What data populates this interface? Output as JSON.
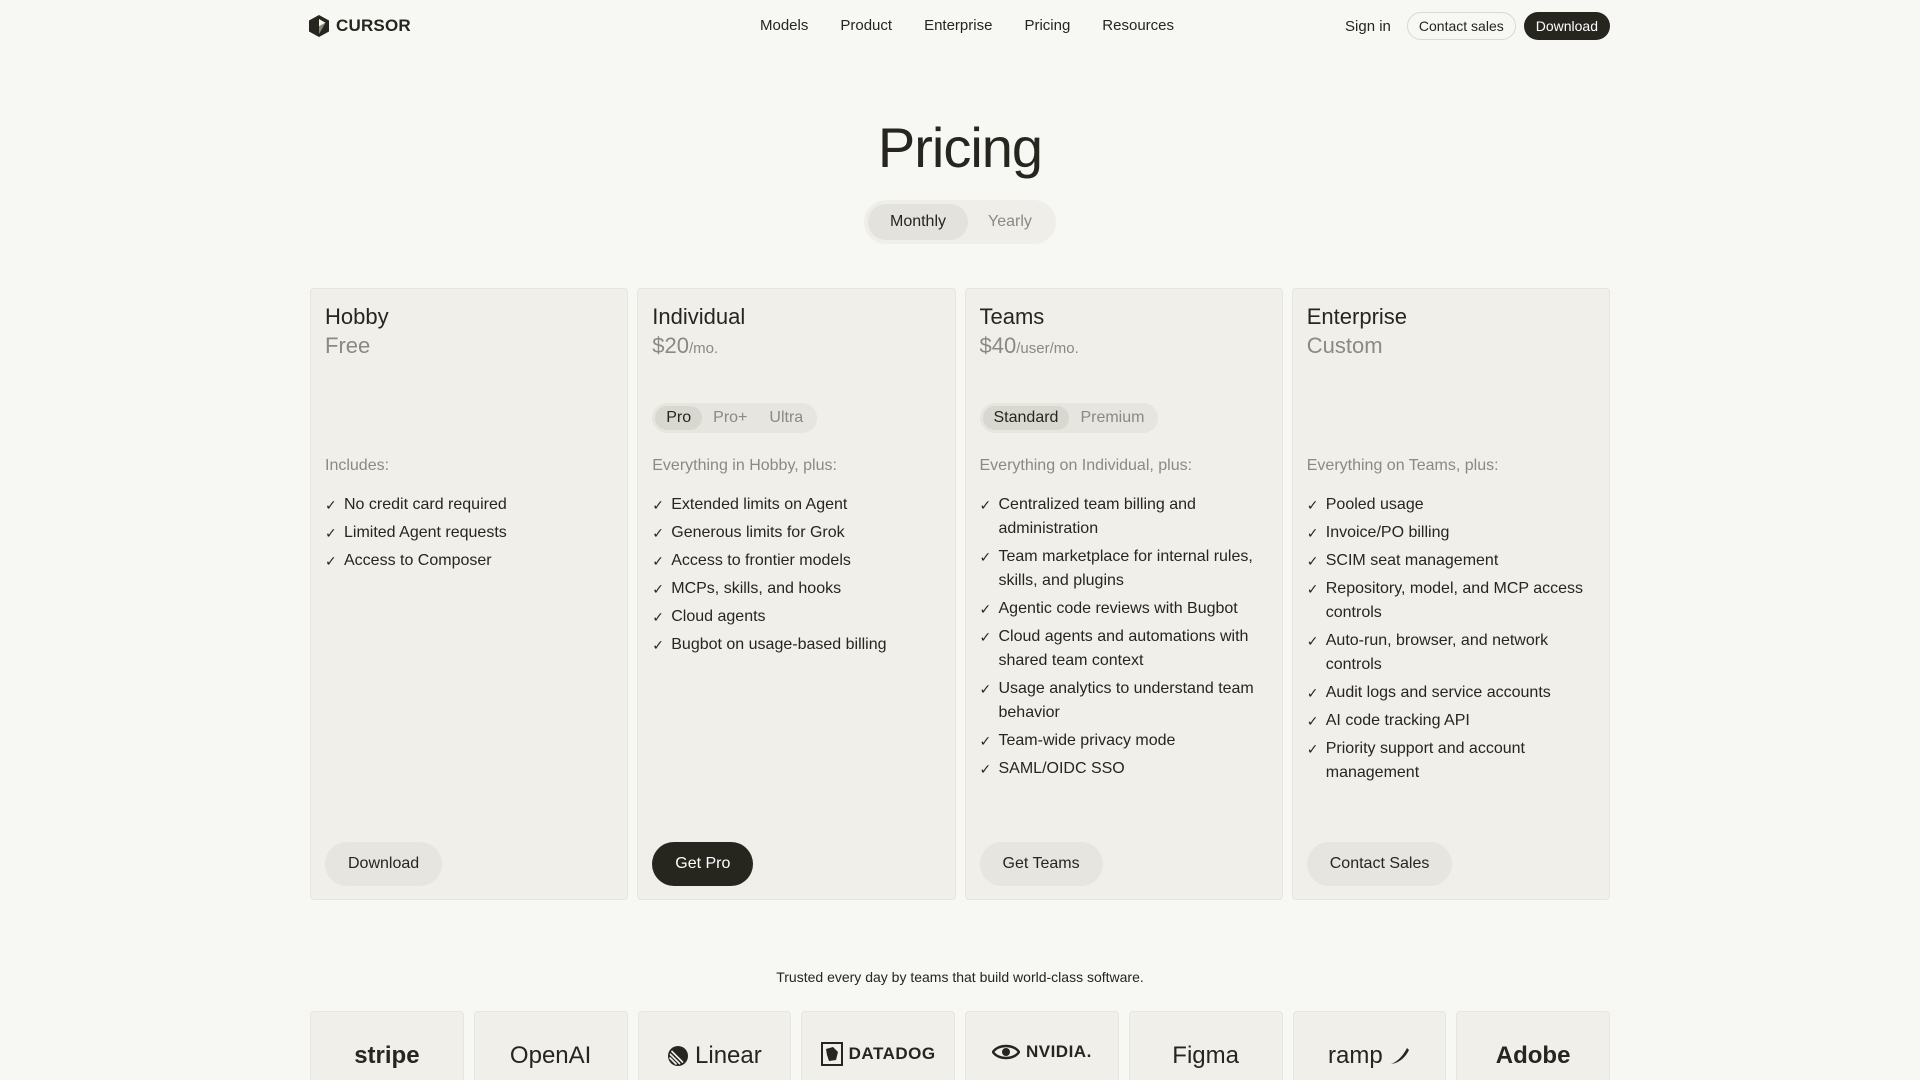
{
  "nav": {
    "brand": "CURSOR",
    "links": [
      "Models",
      "Product",
      "Enterprise",
      "Pricing",
      "Resources"
    ],
    "sign_in": "Sign in",
    "contact_sales": "Contact sales",
    "download": "Download"
  },
  "hero": {
    "title": "Pricing",
    "period_options": [
      "Monthly",
      "Yearly"
    ],
    "selected_period": "Monthly"
  },
  "plans": [
    {
      "name": "Hobby",
      "price": "Free",
      "price_unit": "",
      "tiers": [],
      "includes_label": "Includes:",
      "features": [
        "No credit card required",
        "Limited Agent requests",
        "Access to Composer"
      ],
      "cta": "Download"
    },
    {
      "name": "Individual",
      "price": "$20",
      "price_unit": "/mo.",
      "tiers": [
        "Pro",
        "Pro+",
        "Ultra"
      ],
      "selected_tier": "Pro",
      "includes_label": "Everything in Hobby, plus:",
      "features": [
        "Extended limits on Agent",
        "Generous limits for Grok",
        "Access to frontier models",
        "MCPs, skills, and hooks",
        "Cloud agents",
        "Bugbot on usage-based billing"
      ],
      "cta": "Get Pro"
    },
    {
      "name": "Teams",
      "price": "$40",
      "price_unit": "/user/mo.",
      "tiers": [
        "Standard",
        "Premium"
      ],
      "selected_tier": "Standard",
      "includes_label": "Everything on Individual, plus:",
      "features": [
        "Centralized team billing and administration",
        "Team marketplace for internal rules, skills, and plugins",
        "Agentic code reviews with Bugbot",
        "Cloud agents and automations with shared team context",
        "Usage analytics to understand team behavior",
        "Team-wide privacy mode",
        "SAML/OIDC SSO"
      ],
      "cta": "Get Teams"
    },
    {
      "name": "Enterprise",
      "price": "Custom",
      "price_unit": "",
      "tiers": [],
      "includes_label": "Everything on Teams, plus:",
      "features": [
        "Pooled usage",
        "Invoice/PO billing",
        "SCIM seat management",
        "Repository, model, and MCP access controls",
        "Auto-run, browser, and network controls",
        "Audit logs and service accounts",
        "AI code tracking API",
        "Priority support and account management"
      ],
      "cta": "Contact Sales"
    }
  ],
  "trusted": {
    "text": "Trusted every day by teams that build world-class software.",
    "logos": [
      "stripe",
      "OpenAI",
      "Linear",
      "DATADOG",
      "NVIDIA.",
      "Figma",
      "ramp",
      "Adobe"
    ]
  },
  "colors": {
    "background": "#f7f7f4",
    "card": "#f0efea",
    "text": "#26251e",
    "muted": "#8a8983",
    "dark_button": "#26251e"
  }
}
